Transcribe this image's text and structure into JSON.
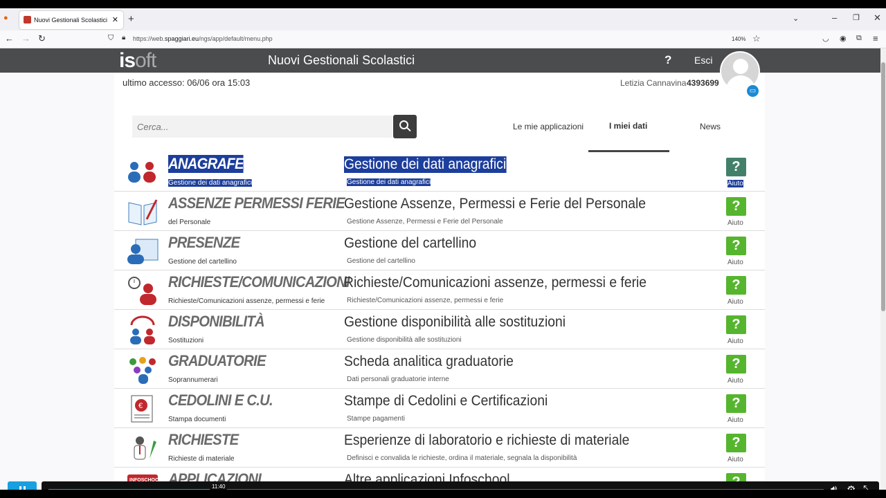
{
  "browser": {
    "tab_title": "Nuovi Gestionali Scolastici",
    "url_prefix": "https://web.",
    "url_domain": "spaggiari.eu",
    "url_path": "/ngs/app/default/menu.php",
    "zoom": "140%"
  },
  "header": {
    "logo_i": "i",
    "logo_soft": "soft",
    "logo_s": "s",
    "title": "Nuovi Gestionali Scolastici",
    "help": "?",
    "logout": "Esci"
  },
  "user": {
    "last_access": "ultimo accesso: 06/06 ora 15:03",
    "name": "Letizia Cannavina",
    "code": "4393699"
  },
  "search": {
    "placeholder": "Cerca..."
  },
  "tabs": [
    {
      "label": "Le mie applicazioni"
    },
    {
      "label": "I miei dati"
    },
    {
      "label": "News"
    }
  ],
  "rows": [
    {
      "name": "ANAGRAFE",
      "sub": "Gestione dei dati anagrafici",
      "desc": "Gestione dei dati anagrafici",
      "desc2": "Gestione dei dati anagrafici",
      "help": "Aiuto",
      "help_symbol": "?"
    },
    {
      "name": "ASSENZE PERMESSI FERIE",
      "sub": "del Personale",
      "desc": "Gestione Assenze, Permessi e Ferie del Personale",
      "desc2": "Gestione Assenze, Permessi e Ferie del Personale",
      "help": "Aiuto",
      "help_symbol": "?"
    },
    {
      "name": "PRESENZE",
      "sub": "Gestione del cartellino",
      "desc": "Gestione del cartellino",
      "desc2": "Gestione del cartellino",
      "help": "Aiuto",
      "help_symbol": "?"
    },
    {
      "name": "RICHIESTE/COMUNICAZIONI",
      "sub": "Richieste/Comunicazioni assenze, permessi e ferie",
      "desc": "Richieste/Comunicazioni assenze, permessi e ferie",
      "desc2": "Richieste/Comunicazioni assenze, permessi e ferie",
      "help": "Aiuto",
      "help_symbol": "?"
    },
    {
      "name": "DISPONIBILITÀ",
      "sub": "Sostituzioni",
      "desc": "Gestione disponibilità alle sostituzioni",
      "desc2": "Gestione disponibilità alle sostituzioni",
      "help": "Aiuto",
      "help_symbol": "?"
    },
    {
      "name": "GRADUATORIE",
      "sub": "Soprannumerari",
      "desc": "Scheda analitica graduatorie",
      "desc2": "Dati personali graduatorie interne",
      "help": "Aiuto",
      "help_symbol": "?"
    },
    {
      "name": "CEDOLINI E C.U.",
      "sub": "Stampa documenti",
      "desc": "Stampe di Cedolini e Certificazioni",
      "desc2": "Stampe pagamenti",
      "help": "Aiuto",
      "help_symbol": "?"
    },
    {
      "name": "RICHIESTE",
      "sub": "Richieste di materiale",
      "desc": "Esperienze di laboratorio e richieste di materiale",
      "desc2": "Definisci e convalida le richieste, ordina il materiale, segnala la disponibilità",
      "help": "Aiuto",
      "help_symbol": "?"
    },
    {
      "name": "APPLICAZIONI",
      "sub": "",
      "desc": "Altre applicazioni Infoschool",
      "desc2": "",
      "help": "",
      "help_symbol": "?",
      "icon_label": "INFOSCHOOL"
    }
  ],
  "video": {
    "time": "11:40",
    "progress": 0.21
  },
  "colors": {
    "help_green": "#56b52e",
    "selection": "#1c3e9c",
    "header_bg": "#4a4c4e",
    "player_accent": "#1aa0e0"
  }
}
